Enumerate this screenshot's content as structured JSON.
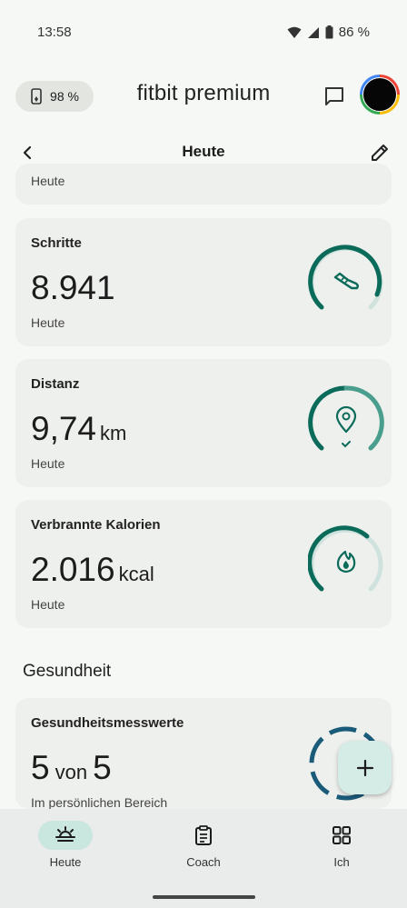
{
  "status": {
    "time": "13:58",
    "battery_pct": "86 %"
  },
  "header": {
    "device_battery": "98 %",
    "brand": "fitbit premium",
    "message_icon": "message-icon",
    "avatar_icon": "profile-avatar"
  },
  "subheader": {
    "title": "Heute",
    "back_icon": "back-arrow-icon",
    "edit_icon": "pencil-icon"
  },
  "colors": {
    "accent": "#0b6b5a",
    "ring_track": "#cfe2dd",
    "ring_mid": "#4a9e8d",
    "health": "#1b5b7a"
  },
  "partial_card": {
    "subtitle": "Heute"
  },
  "cards": [
    {
      "title": "Schritte",
      "value": "8.941",
      "unit": "",
      "subtitle": "Heute",
      "icon": "shoe-icon",
      "progress": 0.89
    },
    {
      "title": "Distanz",
      "value": "9,74",
      "unit": "km",
      "subtitle": "Heute",
      "icon": "location-pin-icon",
      "progress": 1.0
    },
    {
      "title": "Verbrannte Kalorien",
      "value": "2.016",
      "unit": "kcal",
      "subtitle": "Heute",
      "icon": "flame-icon",
      "progress": 0.55
    }
  ],
  "health_section": {
    "title": "Gesundheit",
    "card": {
      "title": "Gesundheitsmesswerte",
      "value": "5",
      "mid": "von",
      "value2": "5",
      "subtitle": "Im persönlichen Bereich"
    }
  },
  "fab": {
    "label": "+"
  },
  "nav": [
    {
      "label": "Heute",
      "icon": "sunrise-icon",
      "active": true
    },
    {
      "label": "Coach",
      "icon": "clipboard-icon",
      "active": false
    },
    {
      "label": "Ich",
      "icon": "grid-icon",
      "active": false
    }
  ]
}
